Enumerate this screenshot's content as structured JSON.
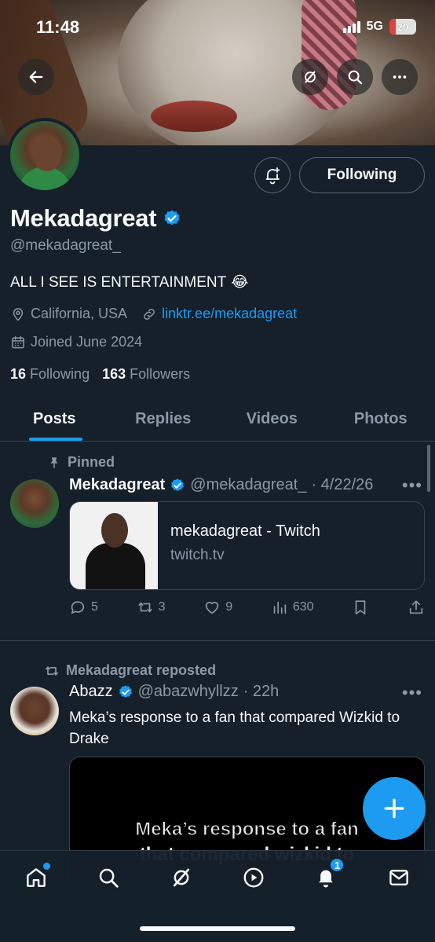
{
  "status_bar": {
    "time": "11:48",
    "network": "5G",
    "battery": "20"
  },
  "profile": {
    "name": "Mekadagreat",
    "handle": "@mekadagreat_",
    "bio": "ALL I SEE IS ENTERTAINMENT",
    "bio_emoji": "😂",
    "location": "California, USA",
    "link": "linktr.ee/mekadagreat",
    "joined": "Joined June 2024",
    "following_count": "16",
    "following_label": "Following",
    "followers_count": "163",
    "followers_label": "Followers",
    "follow_button": "Following"
  },
  "tabs": [
    {
      "label": "Posts",
      "active": true
    },
    {
      "label": "Replies",
      "active": false
    },
    {
      "label": "Videos",
      "active": false
    },
    {
      "label": "Photos",
      "active": false
    }
  ],
  "posts": [
    {
      "context": "Pinned",
      "author": "Mekadagreat",
      "handle": "@mekadagreat_",
      "date": "· 4/22/26",
      "card": {
        "title": "mekadagreat - Twitch",
        "domain": "twitch.tv"
      },
      "replies": "5",
      "reposts": "3",
      "likes": "9",
      "views": "630"
    },
    {
      "context": "Mekadagreat reposted",
      "author": "Abazz",
      "handle": "@abazwhyllzz",
      "date": "· 22h",
      "text": "Meka’s response to a fan that compared Wizkid to Drake",
      "video_caption": "Meka’s response to a fan",
      "video_caption_2": "that compared wizkid to"
    }
  ],
  "nav": {
    "notifications_badge": "1"
  },
  "colors": {
    "background": "#15202b",
    "accent": "#1d9bf0",
    "muted": "#8b98a5",
    "border": "#38444d"
  }
}
